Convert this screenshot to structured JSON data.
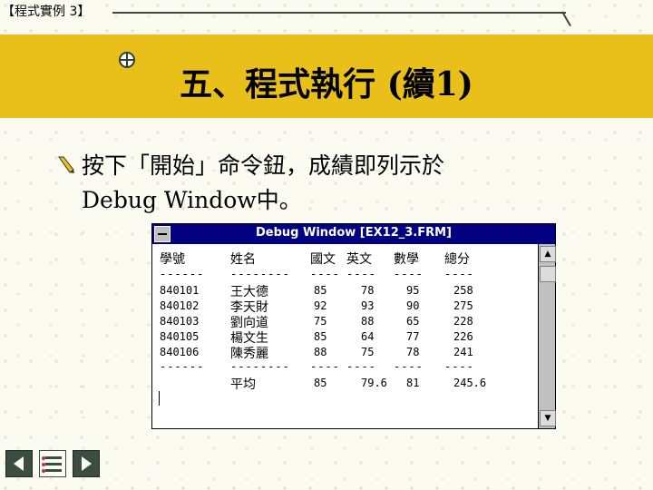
{
  "slide": {
    "header_label": "【程式實例 3】",
    "title": "五、程式執行 (續1)",
    "bullet_line1": "按下「開始」命令鈕，成績即列示於",
    "bullet_line2": "Debug Window中。"
  },
  "debug_window": {
    "title": "Debug Window [EX12_3.FRM]",
    "headers": [
      "學號",
      "姓名",
      "國文",
      "英文",
      "數學",
      "總分"
    ],
    "separators": [
      "------",
      "--------",
      "----",
      "----",
      "----",
      "----"
    ],
    "rows": [
      [
        "840101",
        "王大德",
        "85",
        "78",
        "95",
        "258"
      ],
      [
        "840102",
        "李天財",
        "92",
        "93",
        "90",
        "275"
      ],
      [
        "840103",
        "劉向道",
        "75",
        "88",
        "65",
        "228"
      ],
      [
        "840105",
        "楊文生",
        "85",
        "64",
        "77",
        "226"
      ],
      [
        "840106",
        "陳秀麗",
        "88",
        "75",
        "78",
        "241"
      ]
    ],
    "separators2": [
      "------",
      "--------",
      "----",
      "----",
      "----",
      "----"
    ],
    "average_row": [
      "",
      "平均",
      "85",
      "79.6",
      "81",
      "245.6"
    ]
  },
  "colors": {
    "title_band": "#e8c019",
    "window_titlebar": "#000080",
    "nav_button": "#3a4d3f"
  },
  "icons": {
    "scroll_up": "▲",
    "scroll_down": "▼"
  }
}
